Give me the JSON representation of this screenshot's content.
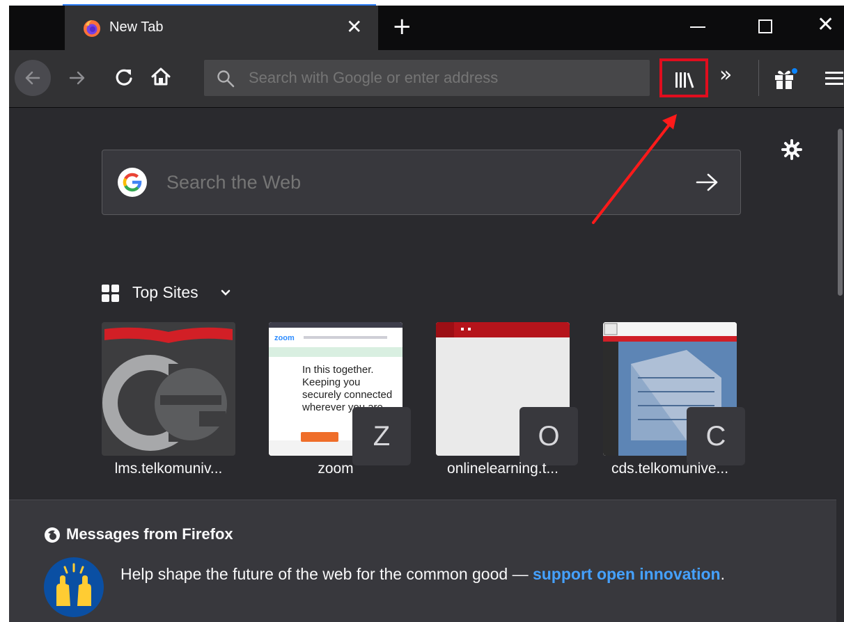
{
  "browser": {
    "tab": {
      "title": "New Tab",
      "close": "✕"
    },
    "new_tab": "+",
    "window_close": "✕",
    "urlbar": {
      "placeholder": "Search with Google or enter address"
    },
    "overflow": "»"
  },
  "newtab": {
    "search": {
      "placeholder": "Search the Web"
    },
    "top_sites": {
      "title": "Top Sites",
      "tiles": [
        {
          "label": "lms.telkomuniv...",
          "letter": ""
        },
        {
          "label": "zoom",
          "letter": "Z",
          "preview_text": "In this together. Keeping you securely connected wherever you are."
        },
        {
          "label": "onlinelearning.t...",
          "letter": "O"
        },
        {
          "label": "cds.telkomunive...",
          "letter": "C"
        }
      ]
    },
    "messages": {
      "title": "Messages from Firefox",
      "body": "Help shape the future of the web for the common good —",
      "link": "support open innovation",
      "end": "."
    }
  },
  "colors": {
    "accent_link": "#45a1ff",
    "highlight_box": "#e00d1e",
    "toolbar": "#323234",
    "page_bg": "#2a2a2e"
  },
  "icons": [
    "firefox-logo-icon",
    "close-icon",
    "plus-icon",
    "minimize-icon",
    "maximize-icon",
    "back-arrow-icon",
    "forward-arrow-icon",
    "reload-icon",
    "home-icon",
    "search-icon",
    "library-icon",
    "chevron-double-right-icon",
    "gift-icon",
    "hamburger-menu-icon",
    "gear-icon",
    "google-logo-icon",
    "arrow-right-icon",
    "grid-icon",
    "chevron-down-icon",
    "firefox-messages-icon",
    "raised-hands-icon"
  ]
}
